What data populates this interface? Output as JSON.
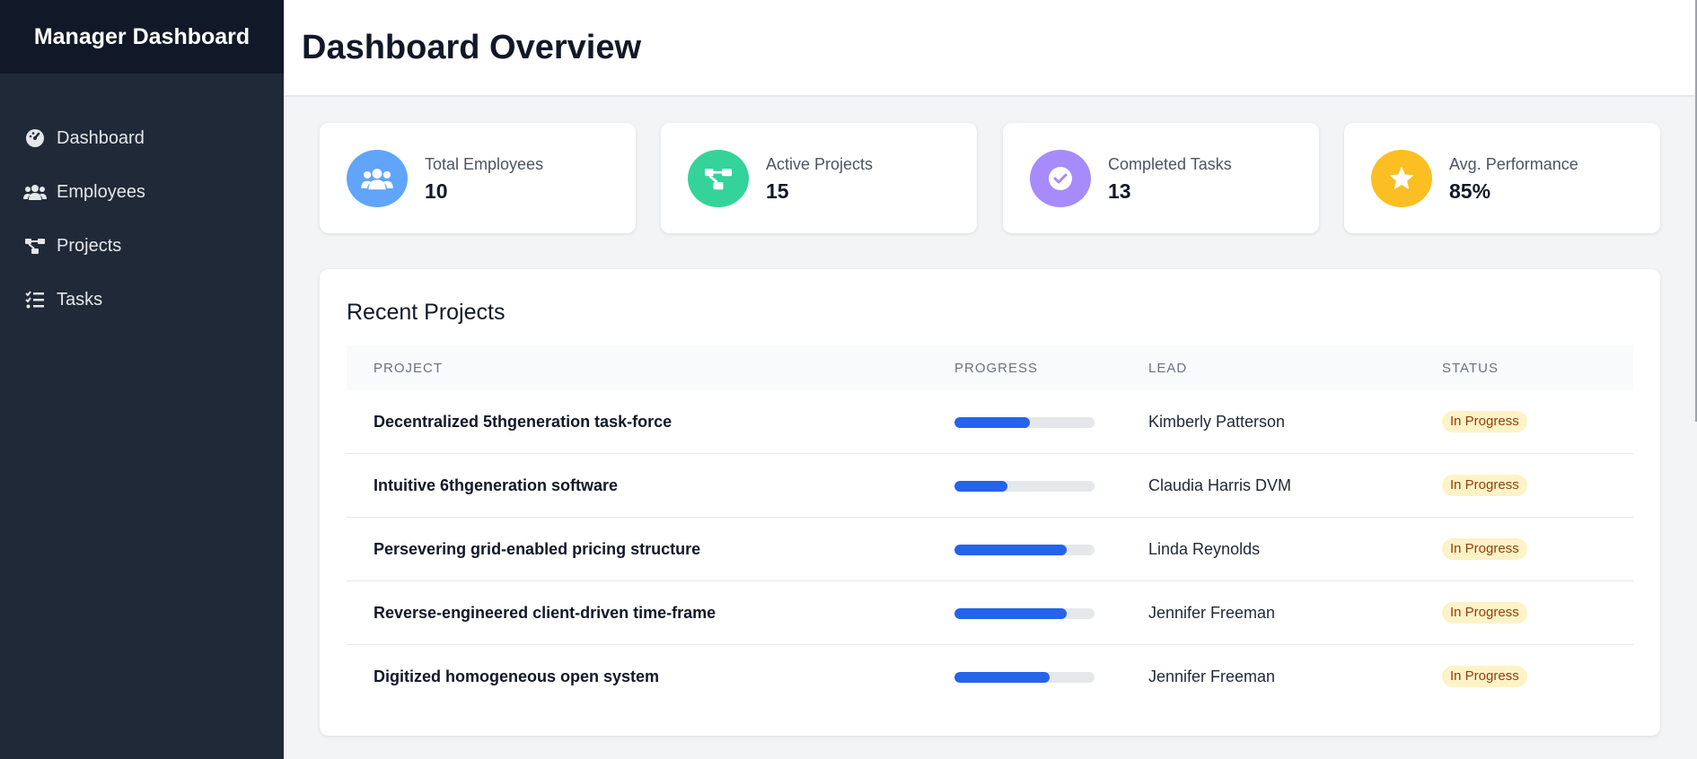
{
  "sidebar": {
    "brand": "Manager Dashboard",
    "items": [
      {
        "label": "Dashboard",
        "icon": "dashboard-icon"
      },
      {
        "label": "Employees",
        "icon": "users-icon"
      },
      {
        "label": "Projects",
        "icon": "project-diagram-icon"
      },
      {
        "label": "Tasks",
        "icon": "tasks-icon"
      }
    ]
  },
  "header": {
    "title": "Dashboard Overview"
  },
  "stats": [
    {
      "label": "Total Employees",
      "value": "10",
      "icon": "users-icon",
      "color": "#60a5fa"
    },
    {
      "label": "Active Projects",
      "value": "15",
      "icon": "project-diagram-icon",
      "color": "#34d399"
    },
    {
      "label": "Completed Tasks",
      "value": "13",
      "icon": "check-circle-icon",
      "color": "#a78bfa"
    },
    {
      "label": "Avg. Performance",
      "value": "85%",
      "icon": "star-icon",
      "color": "#fbbf24"
    }
  ],
  "recent_projects": {
    "title": "Recent Projects",
    "columns": [
      "PROJECT",
      "PROGRESS",
      "LEAD",
      "STATUS"
    ],
    "rows": [
      {
        "name": "Decentralized 5thgeneration task-force",
        "progress": 0.54,
        "lead": "Kimberly Patterson",
        "status": "In Progress"
      },
      {
        "name": "Intuitive 6thgeneration software",
        "progress": 0.38,
        "lead": "Claudia Harris DVM",
        "status": "In Progress"
      },
      {
        "name": "Persevering grid-enabled pricing structure",
        "progress": 0.8,
        "lead": "Linda Reynolds",
        "status": "In Progress"
      },
      {
        "name": "Reverse-engineered client-driven time-frame",
        "progress": 0.8,
        "lead": "Jennifer Freeman",
        "status": "In Progress"
      },
      {
        "name": "Digitized homogeneous open system",
        "progress": 0.68,
        "lead": "Jennifer Freeman",
        "status": "In Progress"
      }
    ]
  },
  "colors": {
    "sidebar_bg": "#1f2937",
    "brand_bg": "#111827",
    "accent": "#2563eb",
    "badge_bg": "#fef3c7",
    "badge_text": "#92400e"
  }
}
